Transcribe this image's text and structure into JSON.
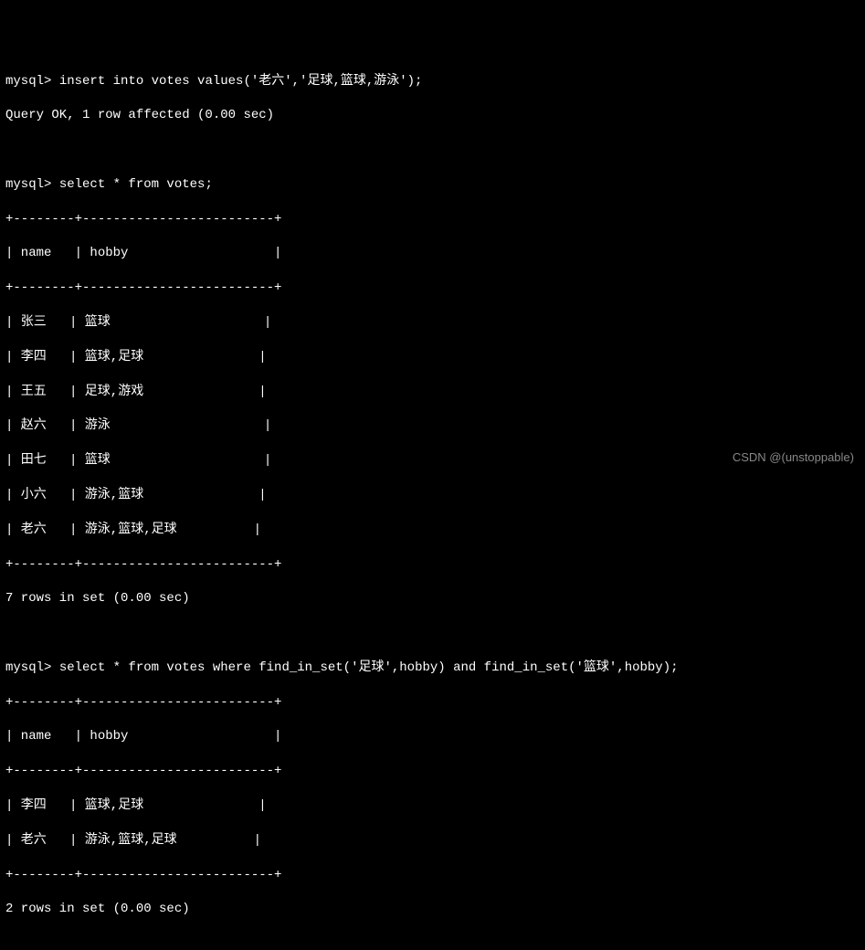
{
  "prompt": "mysql> ",
  "commands": {
    "insert": "insert into votes values('老六','足球,篮球,游泳');",
    "insert_result": "Query OK, 1 row affected (0.00 sec)",
    "select1": "select * from votes;",
    "select2": "select * from votes where find_in_set('足球',hobby) and find_in_set('篮球',hobby);"
  },
  "table": {
    "border_top": "+--------+-------------------------+",
    "header": "| name   | hobby                   |",
    "border_mid": "+--------+-------------------------+",
    "rows1": [
      "| 张三   | 篮球                    |",
      "| 李四   | 篮球,足球               |",
      "| 王五   | 足球,游戏               |",
      "| 赵六   | 游泳                    |",
      "| 田七   | 篮球                    |",
      "| 小六   | 游泳,篮球               |",
      "| 老六   | 游泳,篮球,足球          |"
    ],
    "border_bot": "+--------+-------------------------+",
    "footer1": "7 rows in set (0.00 sec)",
    "rows2": [
      "| 李四   | 篮球,足球               |",
      "| 老六   | 游泳,篮球,足球          |"
    ],
    "footer2": "2 rows in set (0.00 sec)"
  },
  "watermark": "CSDN @(unstoppable)"
}
